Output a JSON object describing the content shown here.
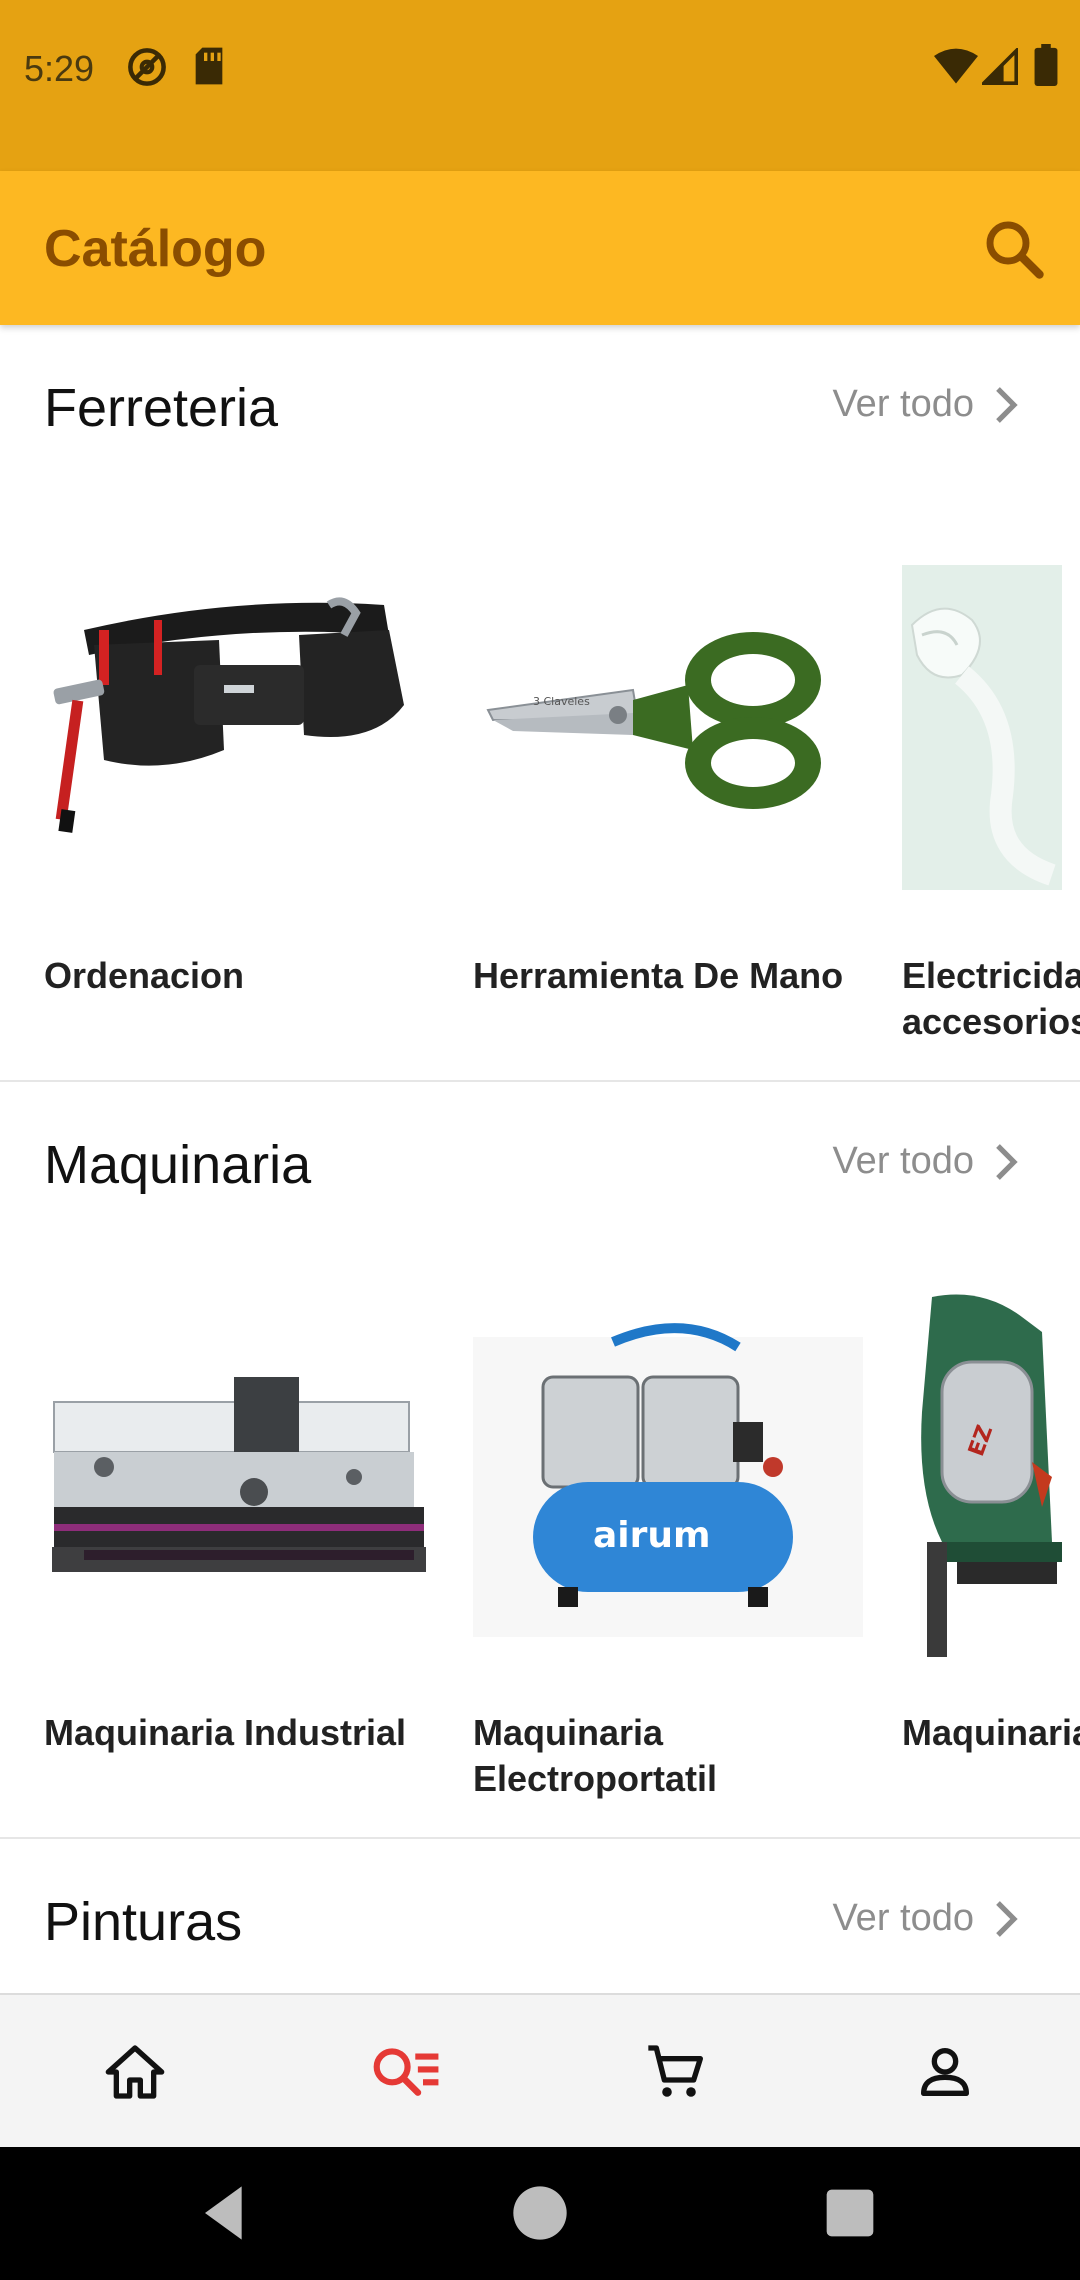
{
  "status_bar": {
    "time": "5:29",
    "icons_left": [
      "do-not-disturb-icon",
      "sd-card-icon"
    ],
    "icons_right": [
      "wifi-icon",
      "signal-icon",
      "battery-icon"
    ]
  },
  "app_bar": {
    "title": "Catálogo",
    "search_icon": "search-icon"
  },
  "sections": [
    {
      "title": "Ferreteria",
      "see_all": "Ver todo",
      "items": [
        {
          "label": "Ordenacion",
          "image": "tool-belt"
        },
        {
          "label": "Herramienta De Mano",
          "image": "scissors"
        },
        {
          "label": "Electricidad accesorios",
          "image": "electrical-tape"
        }
      ]
    },
    {
      "title": "Maquinaria",
      "see_all": "Ver todo",
      "items": [
        {
          "label": "Maquinaria Industrial",
          "image": "lathe"
        },
        {
          "label": "Maquinaria Electroportatil",
          "image": "air-compressor"
        },
        {
          "label": "Maquinaria Madera",
          "image": "nail-gun"
        }
      ]
    },
    {
      "title": "Pinturas",
      "see_all": "Ver todo",
      "items": []
    }
  ],
  "bottom_nav": {
    "items": [
      {
        "name": "home",
        "icon": "home-icon",
        "active": false
      },
      {
        "name": "catalog",
        "icon": "catalog-search-icon",
        "active": true
      },
      {
        "name": "cart",
        "icon": "cart-icon",
        "active": false
      },
      {
        "name": "profile",
        "icon": "person-icon",
        "active": false
      }
    ],
    "active_color": "#e53935"
  },
  "colors": {
    "status_bar": "#e5a212",
    "app_bar": "#fdb822",
    "title_text": "#8a4d00"
  }
}
